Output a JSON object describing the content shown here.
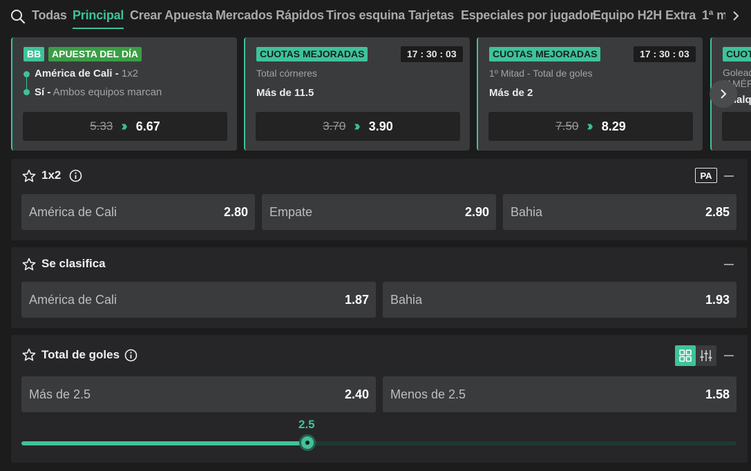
{
  "tabs": [
    {
      "label": "Todas",
      "active": false
    },
    {
      "label": "Principal",
      "active": true
    },
    {
      "label": "Crear Apuesta",
      "active": false
    },
    {
      "label": "Mercados Rápidos",
      "active": false
    },
    {
      "label": "Tiros esquina",
      "active": false
    },
    {
      "label": "Tarjetas",
      "active": false
    },
    {
      "label": "Especiales por jugador",
      "active": false
    },
    {
      "label": "Equipo H2H",
      "active": false
    },
    {
      "label": "Extra",
      "active": false
    },
    {
      "label": "1ª m",
      "active": false
    }
  ],
  "cards": [
    {
      "badge1": "BB",
      "badge2": "APUESTA DEL DÍA",
      "leg1_main": "América de Cali -",
      "leg1_muted": " 1x2",
      "leg2_main": "Sí -",
      "leg2_muted": " Ambos equipos marcan",
      "old_odds": "5.33",
      "new_odds": "6.67"
    },
    {
      "badge": "CUOTAS MEJORADAS",
      "timer": "17 : 30 : 03",
      "market": "Total córneres",
      "selection": "Más de 11.5",
      "old_odds": "3.70",
      "new_odds": "3.90"
    },
    {
      "badge": "CUOTAS MEJORADAS",
      "timer": "17 : 30 : 03",
      "market": "1º Mitad - Total de goles",
      "selection": "Más de 2",
      "old_odds": "7.50",
      "new_odds": "8.29"
    },
    {
      "badge": "CUOTAS MEJORADAS",
      "line1": "Goleado",
      "line2": "(AMÉRICA",
      "line3": "Cualqu"
    }
  ],
  "markets": {
    "m1x2": {
      "title": "1x2",
      "pa_label": "PA",
      "selections": [
        {
          "label": "América de Cali",
          "odds": "2.80"
        },
        {
          "label": "Empate",
          "odds": "2.90"
        },
        {
          "label": "Bahia",
          "odds": "2.85"
        }
      ]
    },
    "clasifica": {
      "title": "Se clasifica",
      "selections": [
        {
          "label": "América de Cali",
          "odds": "1.87"
        },
        {
          "label": "Bahia",
          "odds": "1.93"
        }
      ]
    },
    "goles": {
      "title": "Total de goles",
      "selections": [
        {
          "label": "Más de 2.5",
          "odds": "2.40"
        },
        {
          "label": "Menos de 2.5",
          "odds": "1.58"
        }
      ],
      "slider_value": "2.5",
      "slider_fraction": 0.4
    }
  },
  "colors": {
    "accent": "#3fc29a",
    "day_badge": "#3a9e45",
    "background": "#1c1c1d",
    "panel": "#262628",
    "tile": "#3a3b3d"
  }
}
